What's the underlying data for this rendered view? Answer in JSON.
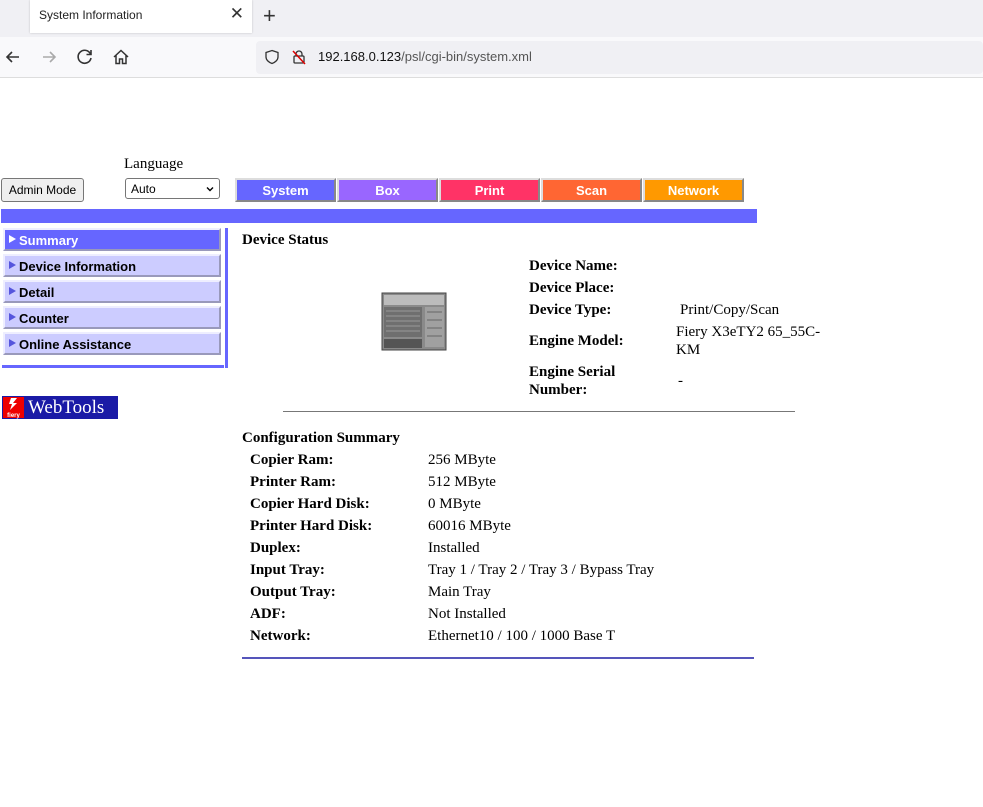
{
  "browser": {
    "tab_title": "System Information",
    "url_host": "192.168.0.123",
    "url_path": "/psl/cgi-bin/system.xml"
  },
  "header": {
    "language_label": "Language",
    "admin_button": "Admin Mode",
    "language_value": "Auto"
  },
  "tabs": [
    {
      "label": "System",
      "color": "#6666ff"
    },
    {
      "label": "Box",
      "color": "#9966ff"
    },
    {
      "label": "Print",
      "color": "#ff3366"
    },
    {
      "label": "Scan",
      "color": "#ff6633"
    },
    {
      "label": "Network",
      "color": "#ff9900"
    }
  ],
  "sidebar": {
    "items": [
      {
        "label": "Summary",
        "active": true
      },
      {
        "label": "Device Information"
      },
      {
        "label": "Detail"
      },
      {
        "label": "Counter"
      },
      {
        "label": "Online Assistance"
      }
    ],
    "logo_text": "WebTools",
    "logo_badge": "fiery"
  },
  "device_status": {
    "title": "Device Status",
    "rows": [
      {
        "label": "Device Name:",
        "value": ""
      },
      {
        "label": "Device Place:",
        "value": ""
      },
      {
        "label": "Device Type:",
        "value": "Print/Copy/Scan"
      },
      {
        "label": "Engine Model:",
        "value": "Fiery X3eTY2 65_55C-KM"
      },
      {
        "label": "Engine Serial Number:",
        "value": "-"
      }
    ]
  },
  "config_summary": {
    "title": "Configuration Summary",
    "rows": [
      {
        "label": "Copier Ram:",
        "value": "256 MByte"
      },
      {
        "label": "Printer Ram:",
        "value": "512 MByte"
      },
      {
        "label": "Copier Hard Disk:",
        "value": "0 MByte"
      },
      {
        "label": "Printer Hard Disk:",
        "value": "60016 MByte"
      },
      {
        "label": "Duplex:",
        "value": "Installed"
      },
      {
        "label": "Input Tray:",
        "value": "Tray 1 / Tray 2 / Tray 3 / Bypass Tray"
      },
      {
        "label": "Output Tray:",
        "value": "Main Tray"
      },
      {
        "label": "ADF:",
        "value": "Not Installed"
      },
      {
        "label": "Network:",
        "value": "Ethernet10 / 100 / 1000 Base T"
      }
    ]
  }
}
